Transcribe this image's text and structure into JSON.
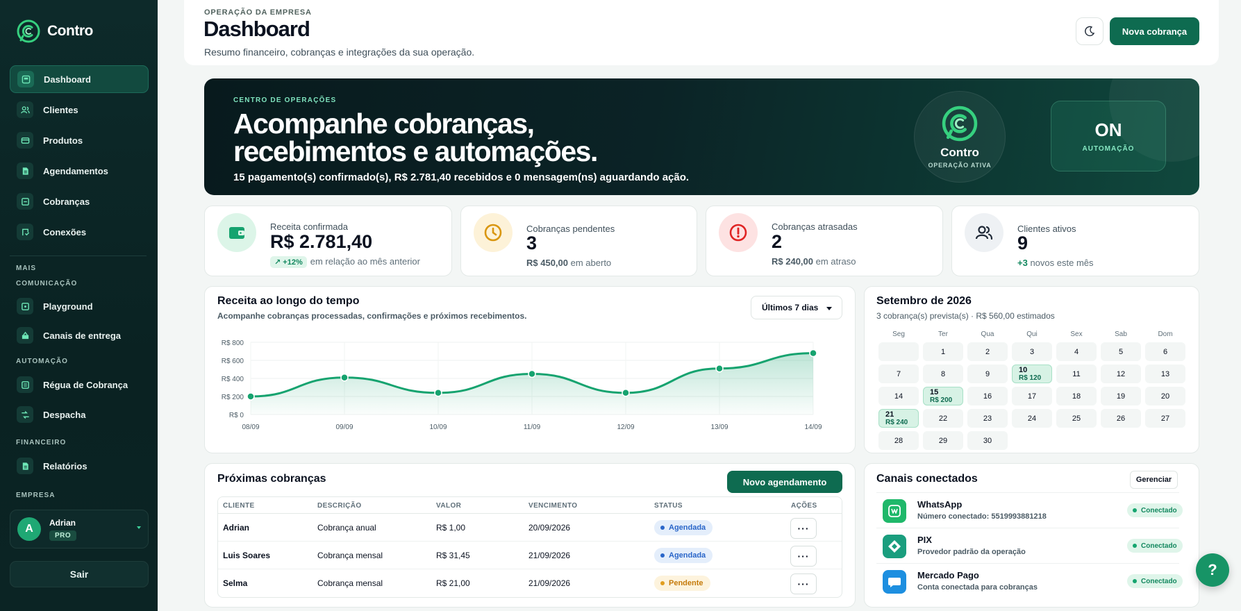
{
  "app": {
    "name": "Contro"
  },
  "sidebar": {
    "items": [
      {
        "label": "Dashboard"
      },
      {
        "label": "Clientes"
      },
      {
        "label": "Produtos"
      },
      {
        "label": "Agendamentos"
      },
      {
        "label": "Cobranças"
      },
      {
        "label": "Conexões"
      }
    ],
    "sections": {
      "mais": "MAIS",
      "comunicacao": "COMUNICAÇÃO",
      "automacao": "AUTOMAÇÃO",
      "financeiro": "FINANCEIRO",
      "empresa": "EMPRESA"
    },
    "comm_items": [
      {
        "label": "Playground"
      },
      {
        "label": "Canais de entrega"
      }
    ],
    "auto_items": [
      {
        "label": "Régua de Cobrança"
      },
      {
        "label": "Despacha"
      }
    ],
    "fin_items": [
      {
        "label": "Relatórios"
      }
    ],
    "user": {
      "initial": "A",
      "name": "Adrian",
      "plan": "PRO"
    },
    "logout_label": "Sair"
  },
  "header": {
    "eyebrow": "OPERAÇÃO DA EMPRESA",
    "title": "Dashboard",
    "subtitle": "Resumo financeiro, cobranças e integrações da sua operação.",
    "new_charge_label": "Nova cobrança"
  },
  "hero": {
    "eyebrow": "CENTRO DE OPERAÇÕES",
    "title_line1": "Acompanhe cobranças,",
    "title_line2": "recebimentos e automações.",
    "summary": "15 pagamento(s) confirmado(s), R$ 2.781,40 recebidos e 0 mensagem(ns) aguardando ação.",
    "logo_name": "Contro",
    "logo_status": "OPERAÇÃO ATIVA",
    "automation_value": "ON",
    "automation_label": "AUTOMAÇÃO"
  },
  "stats": [
    {
      "label": "Receita confirmada",
      "value": "R$ 2.781,40",
      "trend": "+12%",
      "foot": "em relação ao mês anterior",
      "color": "#16a36f"
    },
    {
      "label": "Cobranças pendentes",
      "value": "3",
      "foot_bold": "R$ 450,00",
      "foot": "em aberto",
      "color": "#d9960f"
    },
    {
      "label": "Cobranças atrasadas",
      "value": "2",
      "foot_bold": "R$ 240,00",
      "foot": "em atraso",
      "color": "#e02424"
    },
    {
      "label": "Clientes ativos",
      "value": "9",
      "foot_bold": "+3",
      "foot": "novos este mês",
      "color": "#1f2937"
    }
  ],
  "revenue_chart": {
    "title": "Receita ao longo do tempo",
    "subtitle": "Acompanhe cobranças processadas, confirmações e próximos recebimentos.",
    "range_label": "Últimos 7 dias"
  },
  "chart_data": {
    "type": "area",
    "title": "Receita ao longo do tempo",
    "x": [
      "08/09",
      "09/09",
      "10/09",
      "11/09",
      "12/09",
      "13/09",
      "14/09"
    ],
    "values": [
      200,
      410,
      240,
      450,
      240,
      510,
      680
    ],
    "y_ticks": [
      "R$ 0",
      "R$ 200",
      "R$ 400",
      "R$ 600",
      "R$ 800"
    ],
    "ylim": [
      0,
      800
    ],
    "grid": true,
    "color": "#16a36f"
  },
  "calendar": {
    "title": "Setembro de 2026",
    "subtitle": "3 cobrança(s) prevista(s) · R$ 560,00 estimados",
    "dow": [
      "Seg",
      "Ter",
      "Qua",
      "Qui",
      "Sex",
      "Sab",
      "Dom"
    ],
    "lead_blanks": 1,
    "days": [
      "1",
      "2",
      "3",
      "4",
      "5",
      "6",
      "7",
      "8",
      "9",
      "10",
      "11",
      "12",
      "13",
      "14",
      "15",
      "16",
      "17",
      "18",
      "19",
      "20",
      "21",
      "22",
      "23",
      "24",
      "25",
      "26",
      "27",
      "28",
      "29",
      "30"
    ],
    "events": {
      "10": "R$ 120",
      "15": "R$ 200",
      "21": "R$ 240"
    }
  },
  "upcoming": {
    "title": "Próximas cobranças",
    "new_label": "Novo agendamento",
    "columns": [
      "CLIENTE",
      "DESCRIÇÃO",
      "VALOR",
      "VENCIMENTO",
      "STATUS",
      "AÇÕES"
    ],
    "rows": [
      {
        "cliente": "Adrian",
        "descricao": "Cobrança anual",
        "valor": "R$ 1,00",
        "vencimento": "20/09/2026",
        "status": "Agendada",
        "status_color": "blue"
      },
      {
        "cliente": "Luis Soares",
        "descricao": "Cobrança mensal",
        "valor": "R$ 31,45",
        "vencimento": "21/09/2026",
        "status": "Agendada",
        "status_color": "blue"
      },
      {
        "cliente": "Selma",
        "descricao": "Cobrança mensal",
        "valor": "R$ 21,00",
        "vencimento": "21/09/2026",
        "status": "Pendente",
        "status_color": "amber"
      }
    ],
    "action_label": "···"
  },
  "channels": {
    "title": "Canais conectados",
    "manage_label": "Gerenciar",
    "items": [
      {
        "name": "WhatsApp",
        "sub": "Número conectado: 5519993881218",
        "status": "Conectado",
        "icon": "whatsapp-icon"
      },
      {
        "name": "PIX",
        "sub": "Provedor padrão da operação",
        "status": "Conectado",
        "icon": "pix-icon"
      },
      {
        "name": "Mercado Pago",
        "sub": "Conta conectada para cobranças",
        "status": "Conectado",
        "icon": "mercado-pago-icon"
      }
    ]
  },
  "help_label": "?"
}
